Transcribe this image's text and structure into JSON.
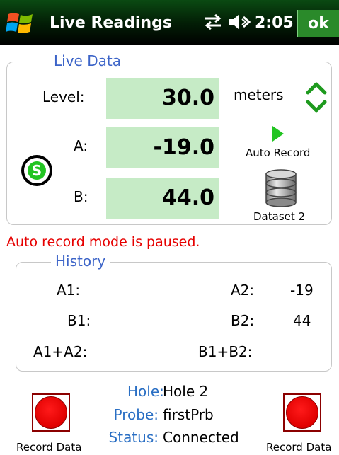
{
  "titlebar": {
    "title": "Live Readings",
    "time": "2:05",
    "ok_label": "ok"
  },
  "live": {
    "group_title": "Live Data",
    "level_label": "Level:",
    "level_value": "30.0",
    "units": "meters",
    "a_label": "A:",
    "a_value": "-19.0",
    "b_label": "B:",
    "b_value": "44.0",
    "status_letter": "S",
    "auto_record_label": "Auto Record",
    "dataset_label": "Dataset 2"
  },
  "paused_message": "Auto record mode is paused.",
  "history": {
    "group_title": "History",
    "a1_label": "A1:",
    "a1_value": "",
    "a2_label": "A2:",
    "a2_value": "-19",
    "b1_label": "B1:",
    "b1_value": "",
    "b2_label": "B2:",
    "b2_value": "44",
    "a_sum_label": "A1+A2:",
    "a_sum_value": "",
    "b_sum_label": "B1+B2:",
    "b_sum_value": ""
  },
  "info": {
    "hole_key": "Hole:",
    "hole_value": "Hole 2",
    "probe_key": "Probe:",
    "probe_value": "firstPrb",
    "status_key": "Status:",
    "status_value": "Connected"
  },
  "record": {
    "left_label": "Record Data",
    "right_label": "Record Data"
  },
  "colors": {
    "title_bar": "#031f06",
    "value_box": "#c6ebc6",
    "group_title": "#3c64c8",
    "info_key": "#2a6fc4",
    "paused_text": "#e60000",
    "record_red": "#e00000",
    "ok_button": "#2a8a2a"
  },
  "icons": {
    "start": "windows-flag-icon",
    "connectivity": "connectivity-arrows-icon",
    "volume": "speaker-icon",
    "up": "chevron-up-icon",
    "down": "chevron-down-icon",
    "play": "play-icon",
    "dataset": "database-icon",
    "status": "status-s-icon",
    "record": "record-icon"
  }
}
